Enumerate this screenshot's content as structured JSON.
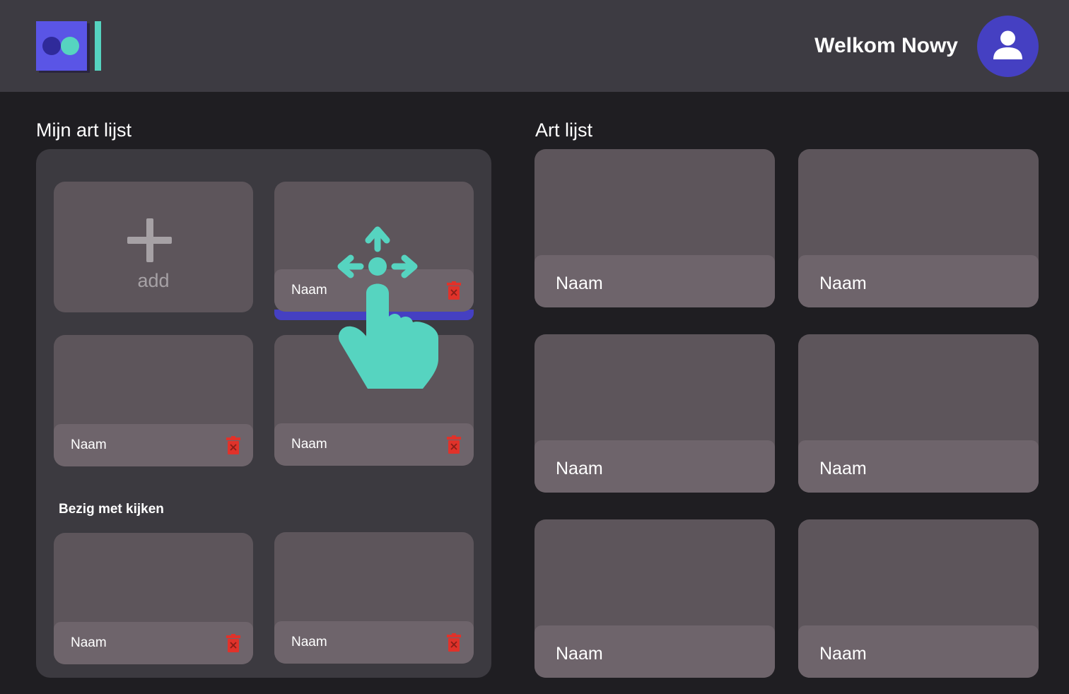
{
  "header": {
    "logo_icon": "app-logo",
    "welcome_text": "Welkom Nowy",
    "avatar_icon": "user-icon"
  },
  "colors": {
    "accent_blue": "#4540c2",
    "accent_teal": "#56d4c0",
    "delete_red": "#e0322a"
  },
  "my_list": {
    "title": "Mijn art lijst",
    "add_label": "add",
    "items": [
      {
        "label": "Naam"
      },
      {
        "label": "Naam"
      },
      {
        "label": "Naam"
      }
    ],
    "watching": {
      "title": "Bezig met kijken",
      "items": [
        {
          "label": "Naam"
        },
        {
          "label": "Naam"
        }
      ]
    },
    "drag_icon": "drag-move-hand-icon"
  },
  "art_list": {
    "title": "Art lijst",
    "items": [
      {
        "label": "Naam"
      },
      {
        "label": "Naam"
      },
      {
        "label": "Naam"
      },
      {
        "label": "Naam"
      },
      {
        "label": "Naam"
      },
      {
        "label": "Naam"
      }
    ]
  }
}
